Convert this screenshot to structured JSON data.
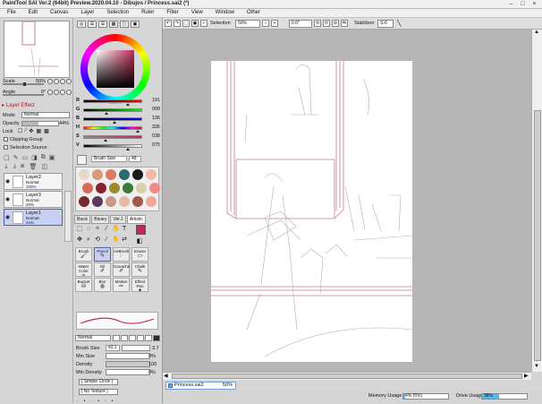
{
  "window": {
    "title": "PaintTool SAI Ver.2 (64bit) Preview.2020.04.10 - Dibujos / Princess.sai2 (*)",
    "controls": [
      "–",
      "□",
      "×"
    ]
  },
  "menu": [
    "File",
    "Edit",
    "Canvas",
    "Layer",
    "Selection",
    "Ruler",
    "Filter",
    "View",
    "Window",
    "Other"
  ],
  "canvas_toolbar": {
    "selection_label": "Selection",
    "zoom": "50%",
    "rotation": "0.0°",
    "stabilizer_label": "Stabilizer",
    "stabilizer_value": "S-6"
  },
  "navigator": {
    "scale_label": "Scale",
    "scale_value": "50%",
    "scale_fraction": 0.5,
    "angle_label": "Angle",
    "angle_value": "0°"
  },
  "layer_panel": {
    "effect_label": "Layer Effect",
    "mode_label": "Mode",
    "mode_value": "Normal",
    "opacity_label": "Opacity",
    "opacity_value": "44%",
    "opacity_fraction": 0.44,
    "lock_label": "Lock",
    "clipping_group": "Clipping Group",
    "selection_source": "Selection Source",
    "layers": [
      {
        "name": "Layer2",
        "mode": "Normal",
        "opacity": "100%",
        "selected": false
      },
      {
        "name": "Layer3",
        "mode": "Normal",
        "opacity": "20%",
        "selected": false
      },
      {
        "name": "Layer1",
        "mode": "Normal",
        "opacity": "44%",
        "selected": true
      }
    ]
  },
  "color": {
    "current": "#c02a56",
    "sliders": [
      {
        "ch": "R",
        "value": "191",
        "fraction": 0.75,
        "gradient": "linear-gradient(to right,#000,#f00)"
      },
      {
        "ch": "G",
        "value": "099",
        "fraction": 0.39,
        "gradient": "linear-gradient(to right,#000,#0f0)"
      },
      {
        "ch": "B",
        "value": "136",
        "fraction": 0.53,
        "gradient": "linear-gradient(to right,#000,#00f)"
      },
      {
        "ch": "H",
        "value": "336",
        "fraction": 0.93,
        "gradient": "linear-gradient(to right,red,#ff0,lime,cyan,blue,#f0f,red)"
      },
      {
        "ch": "S",
        "value": "038",
        "fraction": 0.38,
        "gradient": "linear-gradient(to right,#888,#c02a56)"
      },
      {
        "ch": "V",
        "value": "075",
        "fraction": 0.75,
        "gradient": "linear-gradient(to right,#000,#fff)"
      }
    ],
    "brush_size_label": "Brush Size",
    "brush_size_value": "48",
    "swatches": [
      "#e8d8c8",
      "#d89a78",
      "#e07a5f",
      "#2a6b70",
      "#1a1a1a",
      "#f3b8a8",
      "#d36a5a",
      "#8a2030",
      "#9a8a2a",
      "#3a7a3a",
      "#d8d0a8",
      "#f08a8a",
      "#7a2a2a",
      "#5a3a5a",
      "#c89888",
      "#e8b8a8",
      "#a05a4a",
      "#f0a898"
    ]
  },
  "tool_tabs": [
    "Basic",
    "Binary",
    "Ver.1",
    "Artistic"
  ],
  "brushes": [
    {
      "label": "Brush",
      "icon": "🖌",
      "on": false
    },
    {
      "label": "Pencil",
      "icon": "✎",
      "on": true
    },
    {
      "label": "AirBrush",
      "icon": "◌",
      "on": false
    },
    {
      "label": "Eraser",
      "icon": "▭",
      "on": false
    },
    {
      "label": "Water Color",
      "icon": "≈",
      "on": false
    },
    {
      "label": "Oil",
      "icon": "✐",
      "on": false
    },
    {
      "label": "Gouache",
      "icon": "✐",
      "on": false
    },
    {
      "label": "Chalk",
      "icon": "✎",
      "on": false
    },
    {
      "label": "Bucket",
      "icon": "⛁",
      "on": false
    },
    {
      "label": "Blur",
      "icon": "◍",
      "on": false
    },
    {
      "label": "Marker",
      "icon": "✑",
      "on": false
    },
    {
      "label": "Effect Pen",
      "icon": "✦",
      "on": false
    }
  ],
  "brush_settings": {
    "blend_mode": "Normal",
    "size_label": "Brush Size",
    "size_mult": "x0.1",
    "size_value": "3.7",
    "min_size_label": "Min Size",
    "min_size_value": "0%",
    "density_label": "Density",
    "density_value": "100",
    "min_density_label": "Min Density",
    "min_density_value": "0%",
    "shape": "[ Simple Circle ]",
    "texture": "[ No Texture ]"
  },
  "file_tab": {
    "name": "Princess.sai2",
    "zoom": "50%"
  },
  "status": {
    "memory_label": "Memory Usage",
    "memory_value": "4% (5%)",
    "memory_fraction": 0.04,
    "drive_label": "Drive Usage",
    "drive_value": "38%",
    "drive_fraction": 0.38
  }
}
